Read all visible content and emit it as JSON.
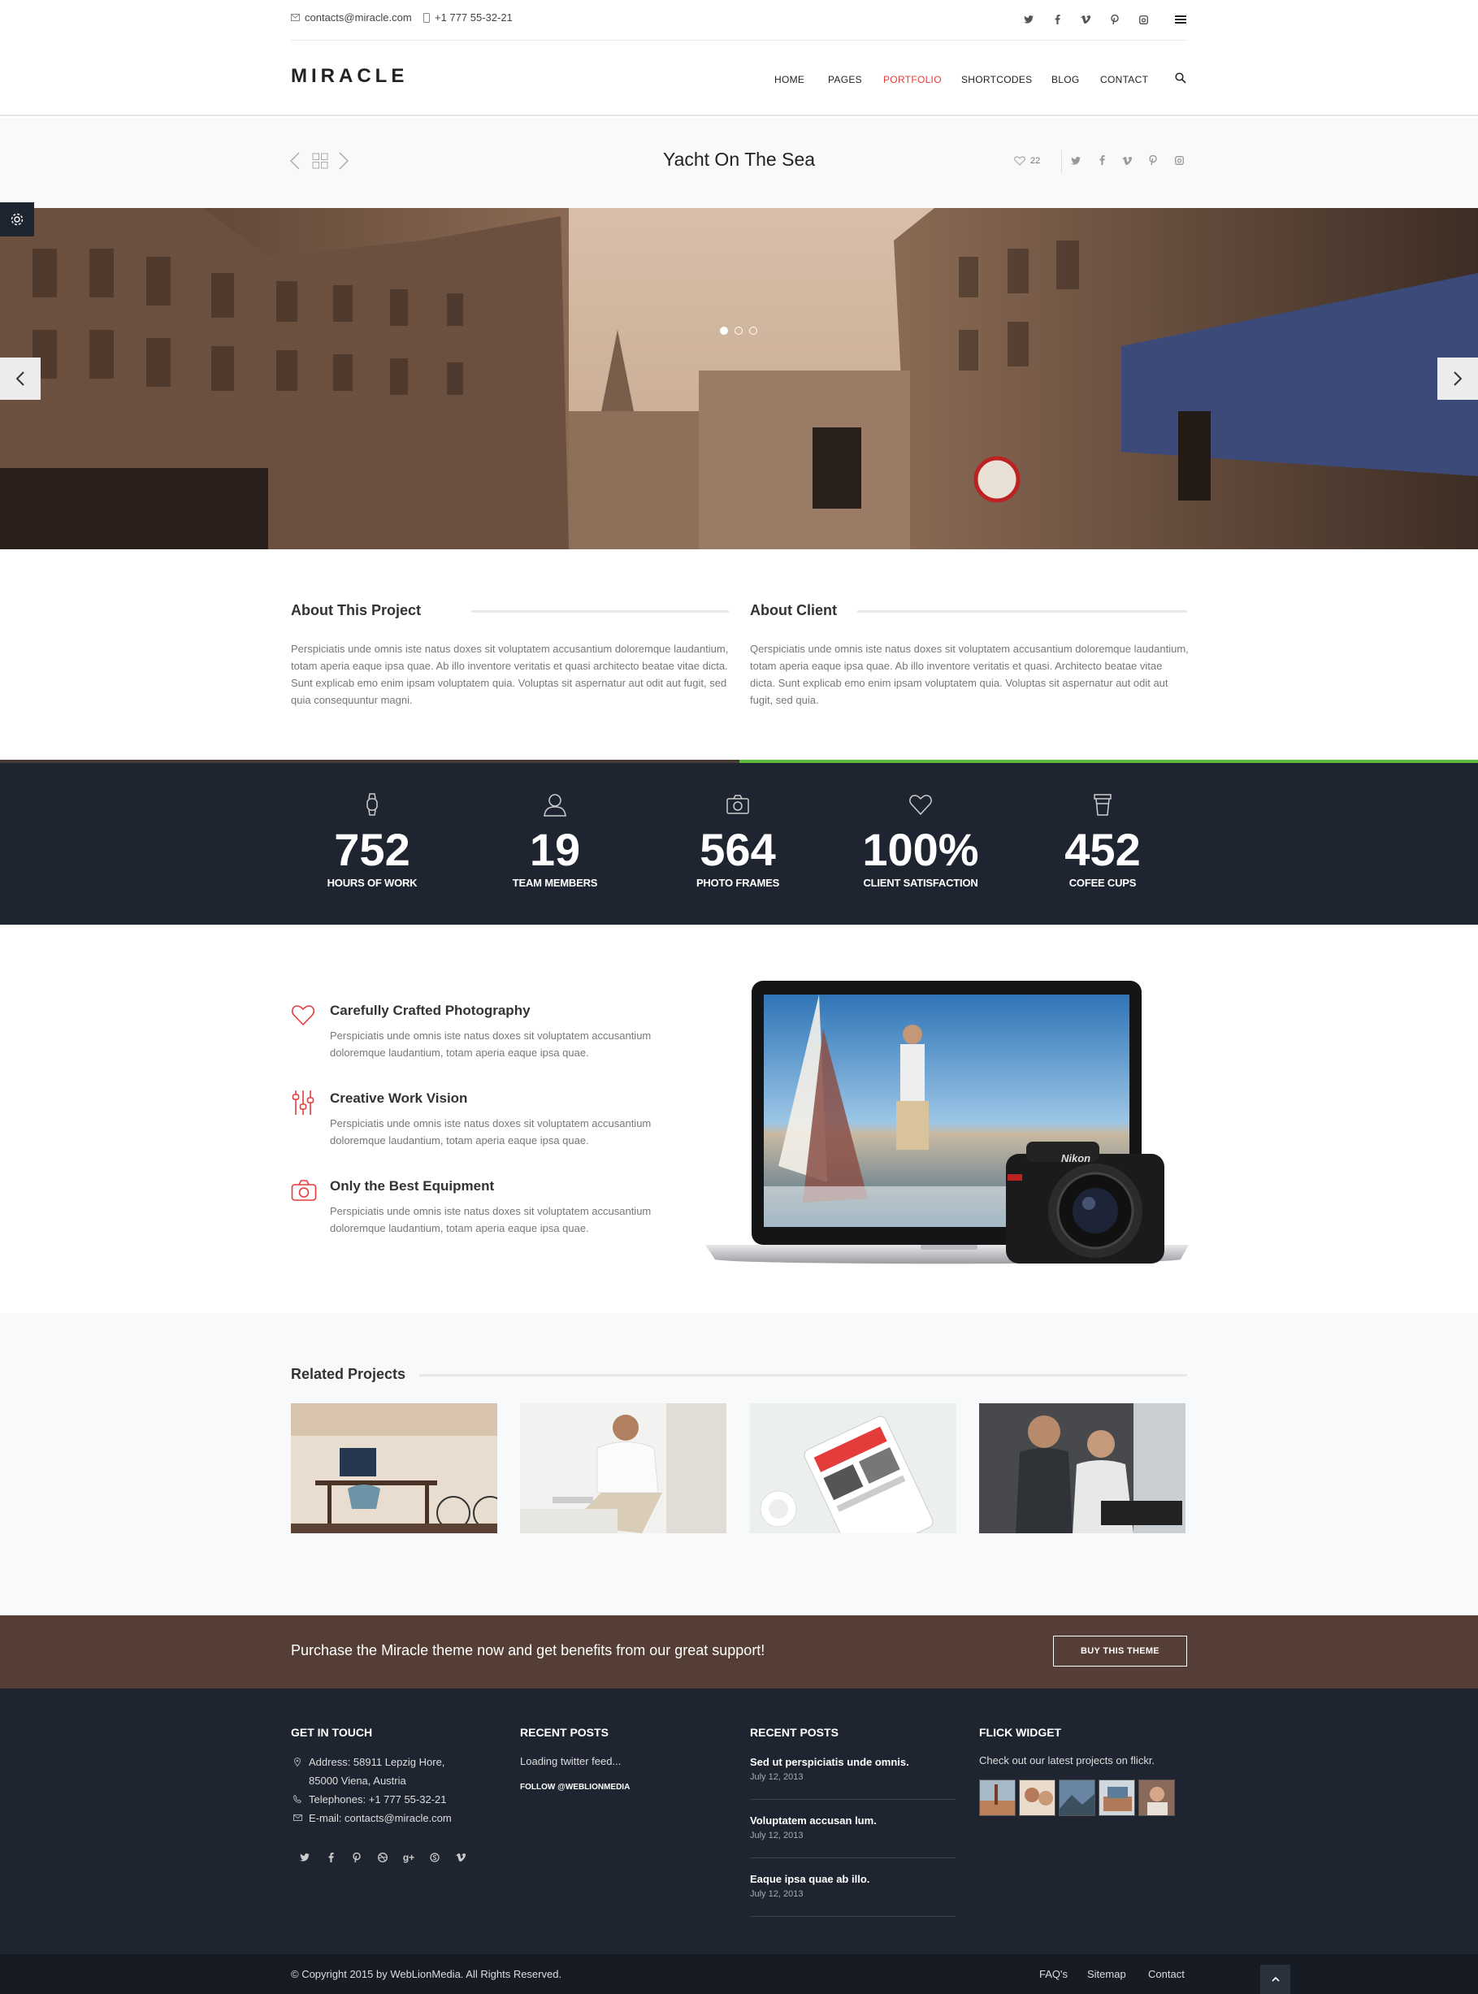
{
  "topbar": {
    "email": "contacts@miracle.com",
    "phone": "+1 777 55-32-21",
    "social_icons": [
      "twitter-icon",
      "facebook-icon",
      "vimeo-icon",
      "pinterest-icon",
      "instagram-icon"
    ]
  },
  "header": {
    "logo": "MIRACLE",
    "nav": [
      "HOME",
      "PAGES",
      "PORTFOLIO",
      "SHORTCODES",
      "BLOG",
      "CONTACT"
    ],
    "active": "PORTFOLIO"
  },
  "project": {
    "title": "Yacht On The Sea",
    "likes": "22"
  },
  "about": {
    "project_title": "About This Project",
    "project_text": "Perspiciatis unde omnis iste natus doxes sit voluptatem accusantium doloremque laudantium, totam aperia eaque ipsa quae. Ab illo inventore veritatis et quasi architecto beatae vitae dicta. Sunt explicab emo enim ipsam voluptatem quia. Voluptas sit aspernatur aut odit aut fugit, sed quia consequuntur magni.",
    "client_title": "About Client",
    "client_text": "Qerspiciatis unde omnis iste natus doxes sit voluptatem accusantium doloremque laudantium, totam aperia eaque ipsa quae. Ab illo inventore veritatis et quasi. Architecto beatae vitae dicta. Sunt explicab emo enim ipsam voluptatem quia. Voluptas sit aspernatur aut odit aut fugit, sed quia."
  },
  "counters": [
    {
      "num": "752",
      "label": "HOURS OF WORK",
      "icon": "watch-icon"
    },
    {
      "num": "19",
      "label": "TEAM MEMBERS",
      "icon": "user-icon"
    },
    {
      "num": "564",
      "label": "PHOTO FRAMES",
      "icon": "camera-icon"
    },
    {
      "num": "100%",
      "label": "CLIENT SATISFACTION",
      "icon": "heart-icon"
    },
    {
      "num": "452",
      "label": "COFEE CUPS",
      "icon": "cup-icon"
    }
  ],
  "features": [
    {
      "title": "Carefully Crafted Photography",
      "text": "Perspiciatis unde omnis iste natus doxes sit voluptatem accusantium doloremque laudantium, totam aperia eaque ipsa quae."
    },
    {
      "title": "Creative Work Vision",
      "text": "Perspiciatis unde omnis iste natus doxes sit voluptatem accusantium doloremque laudantium, totam aperia eaque ipsa quae."
    },
    {
      "title": "Only the Best Equipment",
      "text": "Perspiciatis unde omnis iste natus doxes sit voluptatem accusantium doloremque laudantium, totam aperia eaque ipsa quae."
    }
  ],
  "related": {
    "title": "Related Projects"
  },
  "purchase": {
    "text": "Purchase the Miracle theme now and get benefits from our great support!",
    "button": "BUY THIS THEME"
  },
  "footer": {
    "get_in_touch": {
      "title": "GET IN TOUCH",
      "address1": "Address: 58911 Lepzig Hore,",
      "address2": "85000 Viena, Austria",
      "phone": "Telephones: +1 777 55-32-21",
      "email": "E-mail: contacts@miracle.com"
    },
    "twitter": {
      "title": "RECENT POSTS",
      "loading": "Loading twitter feed...",
      "follow": "FOLLOW @WEBLIONMEDIA"
    },
    "posts": {
      "title": "RECENT POSTS",
      "items": [
        {
          "title": "Sed ut perspiciatis unde omnis.",
          "date": "July 12, 2013"
        },
        {
          "title": "Voluptatem accusan lum.",
          "date": "July 12, 2013"
        },
        {
          "title": "Eaque ipsa quae ab illo.",
          "date": "July 12, 2013"
        }
      ]
    },
    "flickr": {
      "title": "FLICK WIDGET",
      "text": "Check out our latest projects on flickr."
    }
  },
  "bottom": {
    "copyright": "© Copyright 2015 by WebLionMedia. All Rights Reserved.",
    "links": [
      "FAQ's",
      "Sitemap",
      "Contact"
    ]
  },
  "colors": {
    "accent": "#e43b3b",
    "dark": "#1f2530",
    "brown": "#553e36",
    "green": "#5cba3b"
  }
}
